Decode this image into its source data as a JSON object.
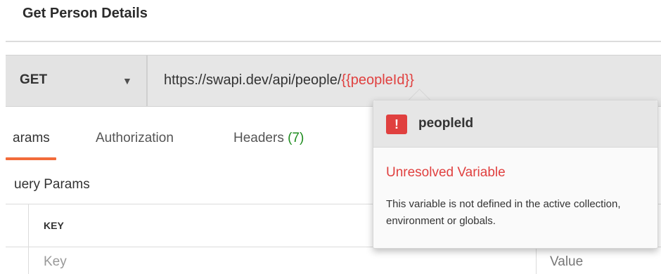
{
  "header": {
    "title": "Get Person Details"
  },
  "request": {
    "method": "GET",
    "url_prefix": "https://swapi.dev/api/people/",
    "url_variable": "{{peopleId}}"
  },
  "tabs": [
    {
      "label": "arams",
      "active": true
    },
    {
      "label": "Authorization",
      "active": false
    },
    {
      "label": "Headers",
      "count": "(7)",
      "active": false
    }
  ],
  "query_params": {
    "title": "uery Params",
    "columns": {
      "key": "KEY"
    },
    "row": {
      "key_placeholder": "Key",
      "value_placeholder": "Value"
    }
  },
  "popup": {
    "badge": "!",
    "variable_name": "peopleId",
    "status": "Unresolved Variable",
    "description": "This variable is not defined in the active collection, environment or globals."
  },
  "colors": {
    "accent": "#f26b3a",
    "error": "#e0403f",
    "count": "#1e8c1e"
  }
}
